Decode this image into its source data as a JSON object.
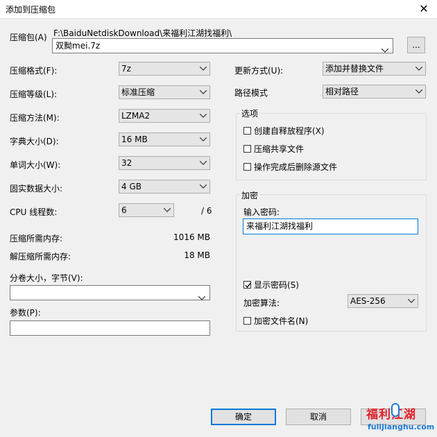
{
  "window": {
    "title": "添加到压缩包",
    "close_glyph": "✕"
  },
  "archive": {
    "label": "压缩包(A)",
    "path": "F:\\BaiduNetdiskDownload\\来福利江湖找福利\\",
    "name": "双黝mei.7z",
    "browse_label": "..."
  },
  "left": {
    "format": {
      "label": "压缩格式(F):",
      "value": "7z"
    },
    "level": {
      "label": "压缩等级(L):",
      "value": "标准压缩"
    },
    "method": {
      "label": "压缩方法(M):",
      "value": "LZMA2"
    },
    "dict": {
      "label": "字典大小(D):",
      "value": "16 MB"
    },
    "word": {
      "label": "单词大小(W):",
      "value": "32"
    },
    "solid": {
      "label": "固实数据大小:",
      "value": "4 GB"
    },
    "threads": {
      "label": "CPU 线程数:",
      "value": "6",
      "total": "/ 6"
    },
    "mem_compress": {
      "label": "压缩所需内存:",
      "value": "1016 MB"
    },
    "mem_decompress": {
      "label": "解压缩所需内存:",
      "value": "18 MB"
    },
    "volume": {
      "label": "分卷大小，字节(V):",
      "value": ""
    },
    "params": {
      "label": "参数(P):",
      "value": ""
    }
  },
  "right": {
    "update": {
      "label": "更新方式(U):",
      "value": "添加并替换文件"
    },
    "path_mode": {
      "label": "路径模式",
      "value": "相对路径"
    },
    "options": {
      "title": "选项",
      "items": [
        {
          "label": "创建自释放程序(X)",
          "checked": false
        },
        {
          "label": "压缩共享文件",
          "checked": false
        },
        {
          "label": "操作完成后删除源文件",
          "checked": false
        }
      ]
    },
    "encryption": {
      "title": "加密",
      "password_label": "输入密码:",
      "password_value": "来福利江湖找福利",
      "show_password": {
        "label": "显示密码(S)",
        "checked": true
      },
      "method_label": "加密算法:",
      "method_value": "AES-256",
      "encrypt_names": {
        "label": "加密文件名(N)",
        "checked": false
      }
    }
  },
  "buttons": {
    "ok": "确定",
    "cancel": "取消"
  },
  "watermark": {
    "logo": "福利江湖",
    "url": "fulijianghu.com"
  }
}
